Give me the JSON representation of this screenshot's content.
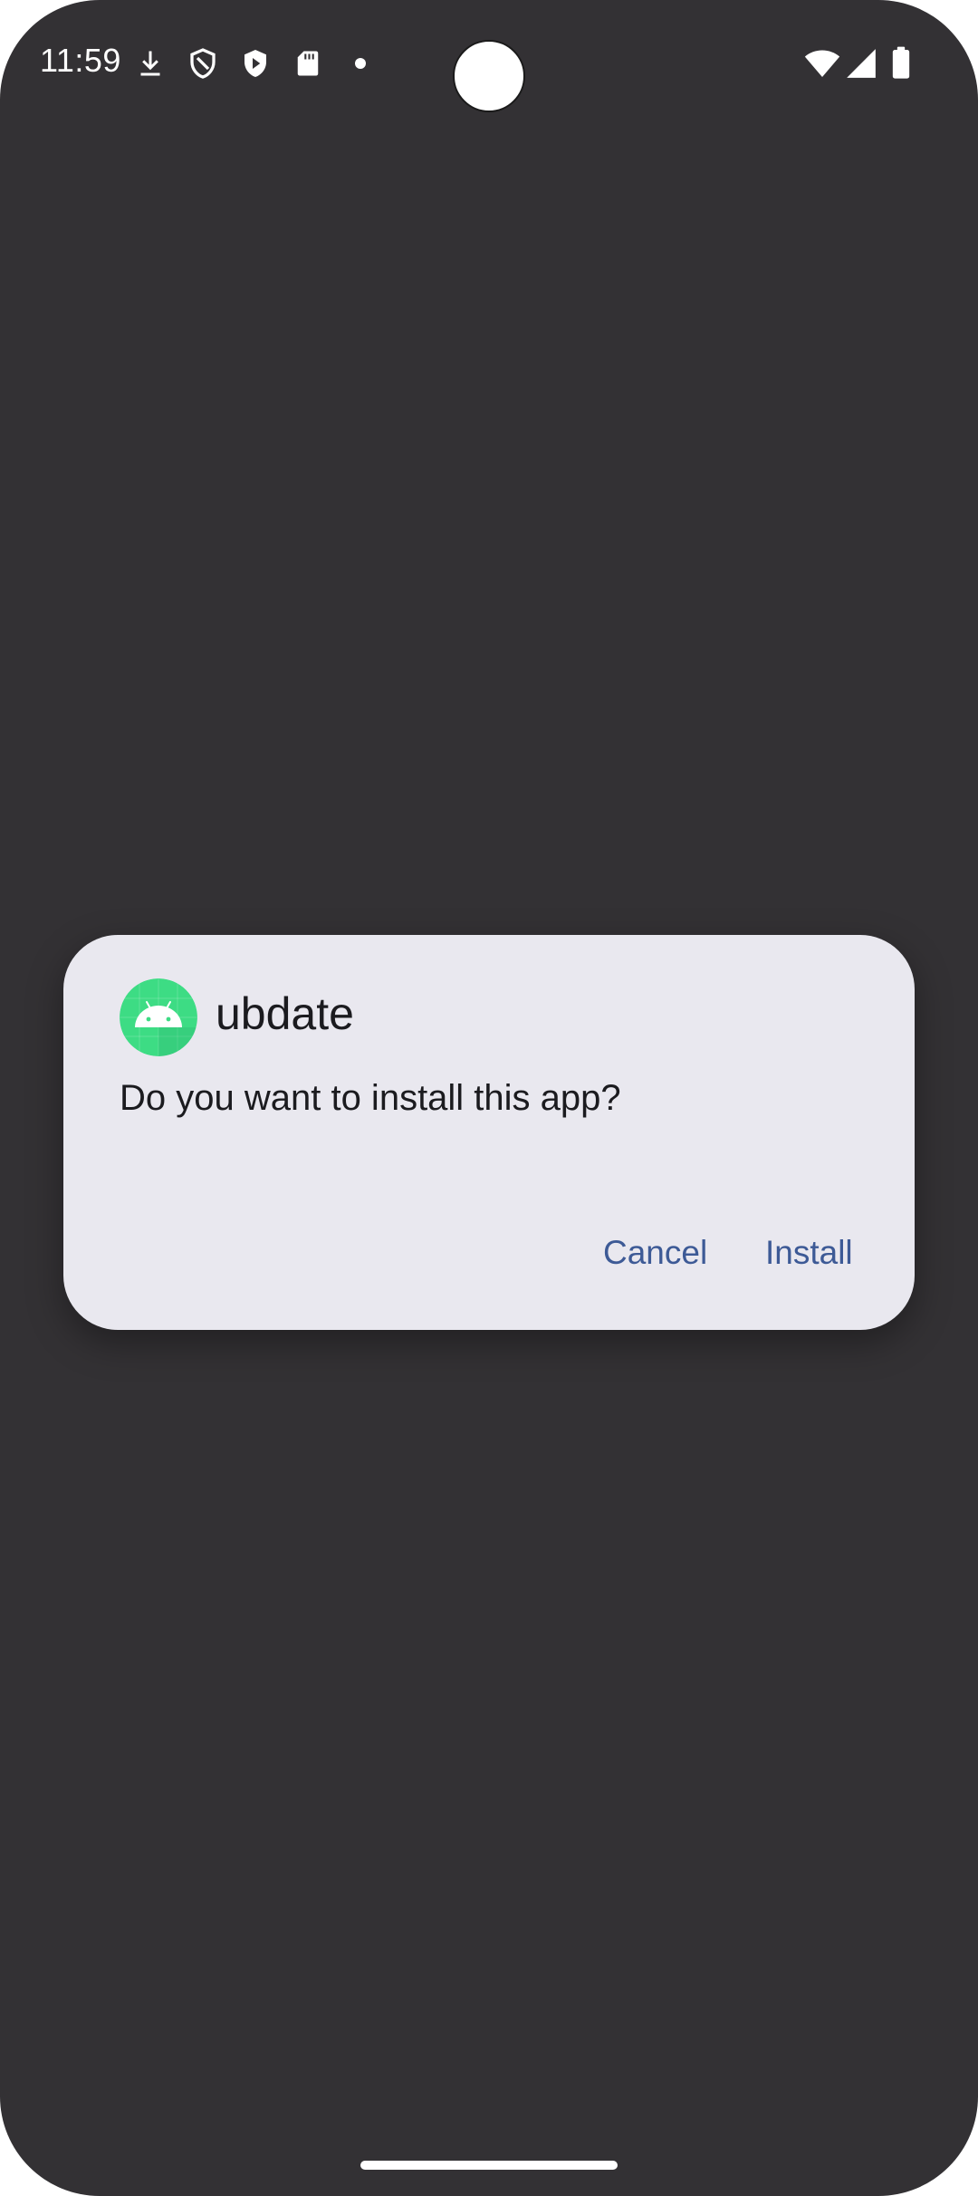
{
  "status_bar": {
    "time": "11:59",
    "left_icons": [
      "download-icon",
      "shield-outline-icon",
      "play-shield-icon",
      "sd-card-icon",
      "notification-dot-icon"
    ],
    "right_icons": [
      "wifi-icon",
      "cellular-signal-icon",
      "battery-icon"
    ]
  },
  "dialog": {
    "app_name": "ubdate",
    "message": "Do you want to install this app?",
    "cancel_label": "Cancel",
    "install_label": "Install",
    "button_color": "#3d5a96",
    "background_color": "#e9e8ef"
  },
  "colors": {
    "screen_background": "#333134",
    "app_icon_green": "#3ddc84"
  }
}
